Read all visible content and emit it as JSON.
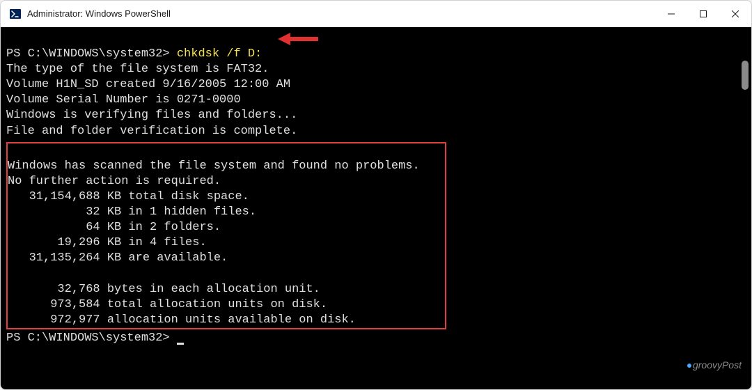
{
  "window": {
    "title": "Administrator: Windows PowerShell"
  },
  "terminal": {
    "prompt1_path": "PS C:\\WINDOWS\\system32> ",
    "command": "chkdsk /f D:",
    "output": {
      "line1": "The type of the file system is FAT32.",
      "line2": "Volume H1N_SD created 9/16/2005 12:00 AM",
      "line3": "Volume Serial Number is 0271-0000",
      "line4": "Windows is verifying files and folders...",
      "line5": "File and folder verification is complete."
    },
    "result": {
      "line1": "Windows has scanned the file system and found no problems.",
      "line2": "No further action is required.",
      "line3": "   31,154,688 KB total disk space.",
      "line4": "           32 KB in 1 hidden files.",
      "line5": "           64 KB in 2 folders.",
      "line6": "       19,296 KB in 4 files.",
      "line7": "   31,135,264 KB are available.",
      "line8": "",
      "line9": "       32,768 bytes in each allocation unit.",
      "line10": "      973,584 total allocation units on disk.",
      "line11": "      972,977 allocation units available on disk."
    },
    "prompt2_path": "PS C:\\WINDOWS\\system32> "
  },
  "annotation": {
    "arrow_color": "#e03030"
  },
  "watermark": {
    "text": "groovyPost"
  }
}
